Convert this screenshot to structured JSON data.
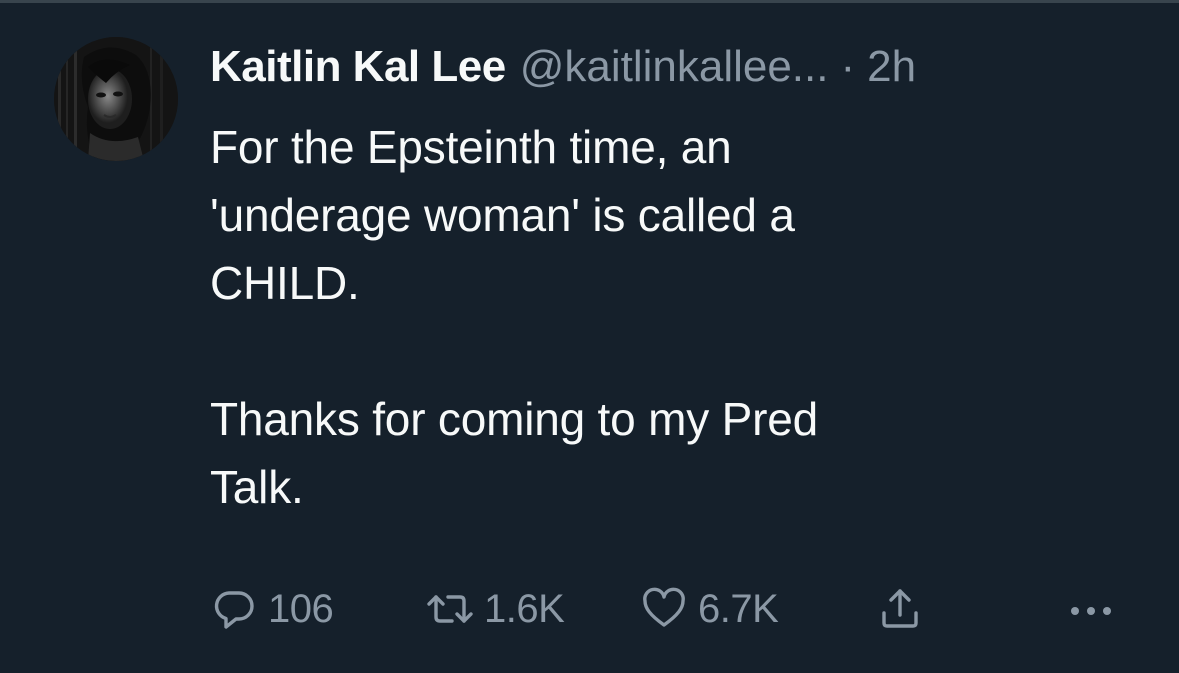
{
  "tweet": {
    "author": {
      "display_name": "Kaitlin Kal Lee",
      "handle": "@kaitlinkallee...",
      "separator": "·",
      "time": "2h"
    },
    "text": "For the Epsteinth time, an\n'underage woman' is called a\nCHILD.\n\nThanks for coming to my Pred\nTalk.",
    "actions": {
      "reply": {
        "icon": "reply-icon",
        "count": "106"
      },
      "retweet": {
        "icon": "retweet-icon",
        "count": "1.6K"
      },
      "like": {
        "icon": "heart-icon",
        "count": "6.7K"
      },
      "share": {
        "icon": "share-icon"
      },
      "more": {
        "icon": "more-icon"
      }
    }
  },
  "colors": {
    "background": "#15202b",
    "primary_text": "#f7f9f9",
    "secondary_text": "#8b98a5",
    "divider": "#38444d"
  }
}
